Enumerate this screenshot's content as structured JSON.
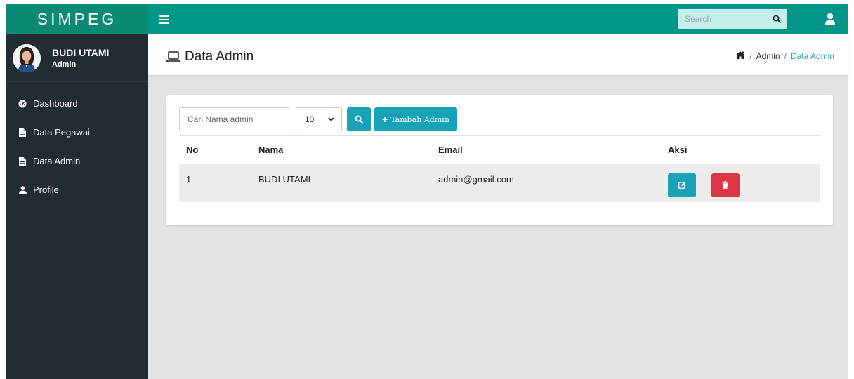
{
  "app": {
    "brand": "SIMPEG"
  },
  "topbar": {
    "search_placeholder": "Search"
  },
  "user": {
    "name": "BUDI UTAMI",
    "role": "Admin"
  },
  "sidebar": {
    "items": [
      {
        "label": "Dashboard",
        "icon": "dashboard-icon"
      },
      {
        "label": "Data Pegawai",
        "icon": "file-icon"
      },
      {
        "label": "Data Admin",
        "icon": "file-icon"
      },
      {
        "label": "Profile",
        "icon": "user-icon"
      }
    ]
  },
  "header": {
    "title": "Data Admin"
  },
  "breadcrumb": {
    "home_icon": "home-icon",
    "parent": "Admin",
    "current": "Data Admin",
    "separator": "/"
  },
  "toolbar": {
    "search_placeholder": "Cari Nama admin",
    "per_page": "10",
    "add_label": "Tambah Admin"
  },
  "table": {
    "headers": [
      "No",
      "Nama",
      "Email",
      "Aksi"
    ],
    "rows": [
      {
        "no": "1",
        "nama": "BUDI UTAMI",
        "email": "admin@gmail.com"
      }
    ]
  },
  "colors": {
    "brand": "#0a8a74",
    "topbar": "#009688",
    "sidebar": "#222d32",
    "info": "#17a2b8",
    "danger": "#dc3545"
  }
}
